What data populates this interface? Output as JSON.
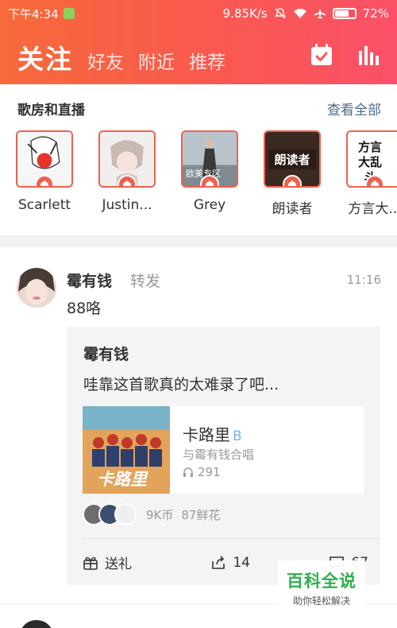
{
  "status_bar": {
    "time": "下午4:34",
    "speed": "9.85K/s",
    "battery": "72%",
    "battery_level": 0.72,
    "icons": [
      "wechat-icon",
      "mute-icon",
      "wifi-icon",
      "airplane-icon",
      "battery-icon"
    ]
  },
  "nav": {
    "active_tab": "关注",
    "tabs": [
      "好友",
      "附近",
      "推荐"
    ],
    "icons": [
      "calendar-check-icon",
      "bar-chart-icon"
    ]
  },
  "rooms": {
    "title": "歌房和直播",
    "more": "查看全部",
    "items": [
      {
        "name": "Scarlett",
        "overlay": ""
      },
      {
        "name": "Justin...",
        "overlay": ""
      },
      {
        "name": "Grey",
        "overlay": "欧美专区"
      },
      {
        "name": "朗读者",
        "overlay": "朗读者"
      },
      {
        "name": "方言大...",
        "overlay": "方言大乱斗"
      }
    ]
  },
  "post": {
    "author": "霉有钱",
    "action": "转发",
    "time": "11:16",
    "text": "88咯",
    "quote": {
      "author": "霉有钱",
      "text": "哇靠这首歌真的太难录了吧...",
      "song": {
        "title": "卡路里",
        "badge": "B",
        "subtitle": "与霉有钱合唱",
        "plays": "291",
        "cover_text": "卡路里"
      },
      "stats": {
        "coins": "9K币",
        "flowers": "87鲜花"
      }
    },
    "actions": {
      "gift": "送礼",
      "share_count": "14",
      "comment_count": "67"
    }
  },
  "watermark": {
    "title": "百科全说",
    "subtitle": "助你轻松解决"
  },
  "colors": {
    "accent": "#f0604e",
    "header_start": "#f76a3a",
    "header_end": "#fb5068",
    "link": "#4a6a8f",
    "watermark": "#2fae4a"
  }
}
